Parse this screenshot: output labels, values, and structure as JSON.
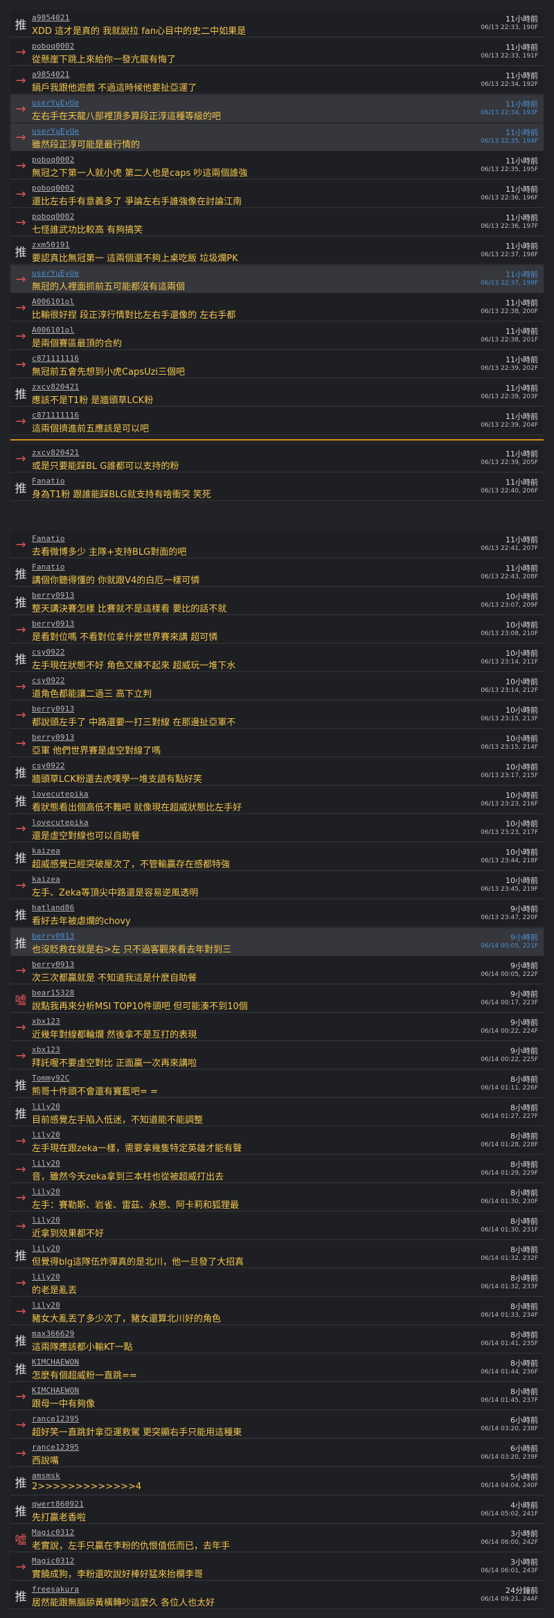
{
  "colors": {
    "background": "#222327",
    "push_text": "#f3c64a",
    "arrow": "#e05454",
    "divider": "#d68e1b",
    "highlight_meta": "#4f8fd1"
  },
  "tag_icons": {
    "push": "推",
    "arrow": "→",
    "boo": "噓"
  },
  "comments": [
    {
      "tag": "推",
      "tag_type": "push",
      "user": "a9854021",
      "text": "XDD 這才是真的 我就說拉 fan心目中的史二中如果是",
      "ago": "11小時前",
      "stamp": "06/13 22:33, 190F"
    },
    {
      "tag": "→",
      "tag_type": "arrow",
      "user": "poboq0002",
      "text": "從懸崖下跳上來給你一發亢龍有悔了",
      "ago": "11小時前",
      "stamp": "06/13 22:33, 191F"
    },
    {
      "tag": "→",
      "tag_type": "arrow",
      "user": "a9854021",
      "text": "鍋戶我跟他遊戲 不過這時候他要扯亞運了",
      "ago": "11小時前",
      "stamp": "06/13 22:34, 192F"
    },
    {
      "tag": "→",
      "tag_type": "arrow",
      "user": "userYuEyUe",
      "text": "左右手在天龍八部裡頂多算段正淳這種等級的吧",
      "ago": "11小時前",
      "stamp": "06/13 22:34, 193F",
      "hl": true
    },
    {
      "tag": "→",
      "tag_type": "arrow",
      "user": "userYuEyUe",
      "text": "雖然段正淳可能是最行情的",
      "ago": "11小時前",
      "stamp": "06/13 22:35, 194F",
      "hl": true
    },
    {
      "tag": "→",
      "tag_type": "arrow",
      "user": "poboq0002",
      "text": "無冠之下第一人就小虎 第二人也是caps 吵這兩個誰強",
      "ago": "11小時前",
      "stamp": "06/13 22:35, 195F"
    },
    {
      "tag": "→",
      "tag_type": "arrow",
      "user": "poboq0002",
      "text": "還比左右手有意義多了 爭論左右手誰強像在討論江南",
      "ago": "11小時前",
      "stamp": "06/13 22:36, 196F"
    },
    {
      "tag": "→",
      "tag_type": "arrow",
      "user": "poboq0002",
      "text": "七怪誰武功比較高 有夠搞笑",
      "ago": "11小時前",
      "stamp": "06/13 22:36, 197F"
    },
    {
      "tag": "推",
      "tag_type": "push",
      "user": "zxm50191",
      "text": "要認真比無冠第一 這兩個還不夠上桌吃飯 垃圾爛PK",
      "ago": "11小時前",
      "stamp": "06/13 22:37, 198F"
    },
    {
      "tag": "→",
      "tag_type": "arrow",
      "user": "userYuEyUe",
      "text": "無冠的人裡面抓前五可能都沒有這兩個",
      "ago": "11小時前",
      "stamp": "06/13 22:37, 199F",
      "hl": true
    },
    {
      "tag": "→",
      "tag_type": "arrow",
      "user": "A006101ol",
      "text": "比輸很好捏 段正淳行情對比左右手還像的 左右手都",
      "ago": "11小時前",
      "stamp": "06/13 22:38, 200F"
    },
    {
      "tag": "→",
      "tag_type": "arrow",
      "user": "A006101ol",
      "text": "是兩個賽區最頂的合約",
      "ago": "11小時前",
      "stamp": "06/13 22:38, 201F"
    },
    {
      "tag": "→",
      "tag_type": "arrow",
      "user": "c871111116",
      "text": "無冠前五會先想到小虎CapsUzi三個吧",
      "ago": "11小時前",
      "stamp": "06/13 22:39, 202F"
    },
    {
      "tag": "推",
      "tag_type": "push",
      "user": "zxcv820421",
      "text": "應該不是T1粉 是牆頭草LCK粉",
      "ago": "11小時前",
      "stamp": "06/13 22:39, 203F"
    },
    {
      "tag": "→",
      "tag_type": "arrow",
      "user": "c871111116",
      "text": "這兩個擠進前五應該是可以吧",
      "ago": "11小時前",
      "stamp": "06/13 22:39, 204F"
    },
    {
      "divider": true
    },
    {
      "tag": "→",
      "tag_type": "arrow",
      "user": "zxcv820421",
      "text": "或是只要能踩BL G誰都可以支持的粉",
      "ago": "11小時前",
      "stamp": "06/13 22:39, 205F"
    },
    {
      "tag": "推",
      "tag_type": "push",
      "user": "Fanatio",
      "text": "身為T1粉 跟誰能踩BLG就支持有啥衝突 笑死",
      "ago": "11小時前",
      "stamp": "06/13 22:40, 206F"
    },
    {
      "gap": true
    },
    {
      "tag": "→",
      "tag_type": "arrow",
      "user": "Fanatio",
      "text": "去看微博多少 主隊+支持BLG對面的吧",
      "ago": "11小時前",
      "stamp": "06/13 22:41, 207F"
    },
    {
      "tag": "推",
      "tag_type": "push",
      "user": "Fanatio",
      "text": "講個你聽得懂的 你就跟V4的白厄一樣可憐",
      "ago": "11小時前",
      "stamp": "06/13 22:43, 208F"
    },
    {
      "tag": "推",
      "tag_type": "push",
      "user": "berry0913",
      "text": "整天講決賽怎樣 比賽就不是這樣看 要比的話不就",
      "ago": "10小時前",
      "stamp": "06/13 23:07, 209F"
    },
    {
      "tag": "→",
      "tag_type": "arrow",
      "user": "berry0913",
      "text": "是看對位嗎 不看對位拿什麼世界賽來講 超可憐",
      "ago": "10小時前",
      "stamp": "06/13 23:08, 210F"
    },
    {
      "tag": "推",
      "tag_type": "push",
      "user": "csy0922",
      "text": "左手現在狀態不好 角色又練不起來 超威玩一堆下水",
      "ago": "10小時前",
      "stamp": "06/13 23:14, 211F"
    },
    {
      "tag": "→",
      "tag_type": "arrow",
      "user": "csy0922",
      "text": "道角色都能讓二過三 高下立判",
      "ago": "10小時前",
      "stamp": "06/13 23:14, 212F"
    },
    {
      "tag": "→",
      "tag_type": "arrow",
      "user": "berry0913",
      "text": "都說頭左手了 中路還要一打三對線 在那邊扯亞軍不",
      "ago": "10小時前",
      "stamp": "06/13 23:15, 213F"
    },
    {
      "tag": "→",
      "tag_type": "arrow",
      "user": "berry0913",
      "text": "亞軍 他們世界賽是虛空對線了嗎",
      "ago": "10小時前",
      "stamp": "06/13 23:15, 214F"
    },
    {
      "tag": "推",
      "tag_type": "push",
      "user": "csy0922",
      "text": "牆頭草LCK粉還去虎噗學一堆支語有點好笑",
      "ago": "10小時前",
      "stamp": "06/13 23:17, 215F"
    },
    {
      "tag": "推",
      "tag_type": "push",
      "user": "lovecutepika",
      "text": "看狀態看出個高低不難吧 就像現在超威狀態比左手好",
      "ago": "10小時前",
      "stamp": "06/13 23:23, 216F"
    },
    {
      "tag": "→",
      "tag_type": "arrow",
      "user": "lovecutepika",
      "text": "還是虛空對線也可以自助餐",
      "ago": "10小時前",
      "stamp": "06/13 23:23, 217F"
    },
    {
      "tag": "推",
      "tag_type": "push",
      "user": "kaizea",
      "text": "超威感覺已經突破屋次了，不管輸贏存在感都特強",
      "ago": "10小時前",
      "stamp": "06/13 23:44, 218F"
    },
    {
      "tag": "→",
      "tag_type": "arrow",
      "user": "kaizea",
      "text": "左手、Zeka等頂尖中路還是容易逆風透明",
      "ago": "10小時前",
      "stamp": "06/13 23:45, 219F"
    },
    {
      "tag": "推",
      "tag_type": "push",
      "user": "hatland86",
      "text": "看好去年被虐爛的chovy",
      "ago": "9小時前",
      "stamp": "06/13 23:47, 220F"
    },
    {
      "tag": "推",
      "tag_type": "push",
      "user": "berry0913",
      "text": "也沒貶救在就是右>左 只不過客觀來看去年對到三",
      "ago": "9小時前",
      "stamp": "06/14 00:05, 221F",
      "hl": true
    },
    {
      "tag": "→",
      "tag_type": "arrow",
      "user": "berry0913",
      "text": "次三次都贏就是 不知道我這是什麼自助餐",
      "ago": "9小時前",
      "stamp": "06/14 00:05, 222F"
    },
    {
      "tag": "噓",
      "tag_type": "boo",
      "user": "bear15328",
      "text": "說點我再來分析MSI TOP10件頭吧 但可能湊不到10個",
      "ago": "9小時前",
      "stamp": "06/14 00:17, 223F"
    },
    {
      "tag": "→",
      "tag_type": "arrow",
      "user": "xbx123",
      "text": "近幾年對線都輪爛 然後拿不是互打的表現",
      "ago": "9小時前",
      "stamp": "06/14 00:22, 224F"
    },
    {
      "tag": "→",
      "tag_type": "arrow",
      "user": "xbx123",
      "text": "拜託喔不要虛空對比 正面贏一次再來講啦",
      "ago": "9小時前",
      "stamp": "06/14 00:22, 225F"
    },
    {
      "tag": "推",
      "tag_type": "push",
      "user": "Tommy92C",
      "text": "熊哥十件頭不會還有寶藍吧= =",
      "ago": "8小時前",
      "stamp": "06/14 01:11, 226F"
    },
    {
      "tag": "推",
      "tag_type": "push",
      "user": "lily20",
      "text": "目前感覺左手陷入低迷，不知道能不能調整",
      "ago": "8小時前",
      "stamp": "06/14 01:27, 227F"
    },
    {
      "tag": "→",
      "tag_type": "arrow",
      "user": "lily20",
      "text": "左手現在跟zeka一樣，需要拿幾隻特定英雄才能有聲",
      "ago": "8小時前",
      "stamp": "06/14 01:28, 228F"
    },
    {
      "tag": "→",
      "tag_type": "arrow",
      "user": "lily20",
      "text": "音，雖然今天zeka拿到三本柱也從被超威打出去",
      "ago": "8小時前",
      "stamp": "06/14 01:29, 229F"
    },
    {
      "tag": "→",
      "tag_type": "arrow",
      "user": "lily20",
      "text": "左手：賽勒斯、岩雀、雷茲、永恩、阿卡莉和狐狸最",
      "ago": "8小時前",
      "stamp": "06/14 01:30, 230F"
    },
    {
      "tag": "→",
      "tag_type": "arrow",
      "user": "lily20",
      "text": "近拿到效果都不好",
      "ago": "8小時前",
      "stamp": "06/14 01:30, 231F"
    },
    {
      "tag": "推",
      "tag_type": "push",
      "user": "lily20",
      "text": "但覺得blg這隊伍炸彈真的是北川，他一旦發了大招真",
      "ago": "8小時前",
      "stamp": "06/14 01:32, 232F"
    },
    {
      "tag": "→",
      "tag_type": "arrow",
      "user": "lily20",
      "text": "的老是亂丟",
      "ago": "8小時前",
      "stamp": "06/14 01:32, 233F"
    },
    {
      "tag": "→",
      "tag_type": "arrow",
      "user": "lily20",
      "text": "豬女大亂丟了多少次了，豬女還算北川好的角色",
      "ago": "8小時前",
      "stamp": "06/14 01:33, 234F"
    },
    {
      "tag": "推",
      "tag_type": "push",
      "user": "max366629",
      "text": "這兩隊應該都小輸KT一點",
      "ago": "8小時前",
      "stamp": "06/14 01:41, 235F"
    },
    {
      "tag": "推",
      "tag_type": "push",
      "user": "KIMCHAEWON",
      "text": "怎麼有個超威粉一直跳==",
      "ago": "8小時前",
      "stamp": "06/14 01:44, 236F"
    },
    {
      "tag": "→",
      "tag_type": "arrow",
      "user": "KIMCHAEWON",
      "text": "跟母一中有夠像",
      "ago": "8小時前",
      "stamp": "06/14 01:45, 237F"
    },
    {
      "tag": "→",
      "tag_type": "arrow",
      "user": "rance12395",
      "text": "超好笑一直跳針拿亞運救駕 更突顯右手只能用這種東",
      "ago": "6小時前",
      "stamp": "06/14 03:20, 238F"
    },
    {
      "tag": "→",
      "tag_type": "arrow",
      "user": "rance12395",
      "text": "西說嘴",
      "ago": "6小時前",
      "stamp": "06/14 03:20, 239F"
    },
    {
      "tag": "推",
      "tag_type": "push",
      "user": "amsmsk",
      "text": "2>>>>>>>>>>>>>4",
      "ago": "5小時前",
      "stamp": "06/14 04:04, 240F"
    },
    {
      "tag": "推",
      "tag_type": "push",
      "user": "qwert860921",
      "text": "先打贏老香啦",
      "ago": "4小時前",
      "stamp": "06/14 05:02, 241F"
    },
    {
      "tag": "噓",
      "tag_type": "boo",
      "user": "Magic0312",
      "text": "老實說，左手只贏在李粉的仇恨值低而已，去年手",
      "ago": "3小時前",
      "stamp": "06/14 06:00, 242F"
    },
    {
      "tag": "→",
      "tag_type": "arrow",
      "user": "Magic0312",
      "text": "實饒成狗，李粉還吹說好棒好猛來抬欄李哥",
      "ago": "3小時前",
      "stamp": "06/14 06:01, 243F"
    },
    {
      "tag": "推",
      "tag_type": "push",
      "user": "freesakura",
      "text": "居然能跟無腦舔黃橫轉吵這麼久 各位人也太好",
      "ago": "24分鐘前",
      "stamp": "06/14 09:21, 244F"
    }
  ]
}
